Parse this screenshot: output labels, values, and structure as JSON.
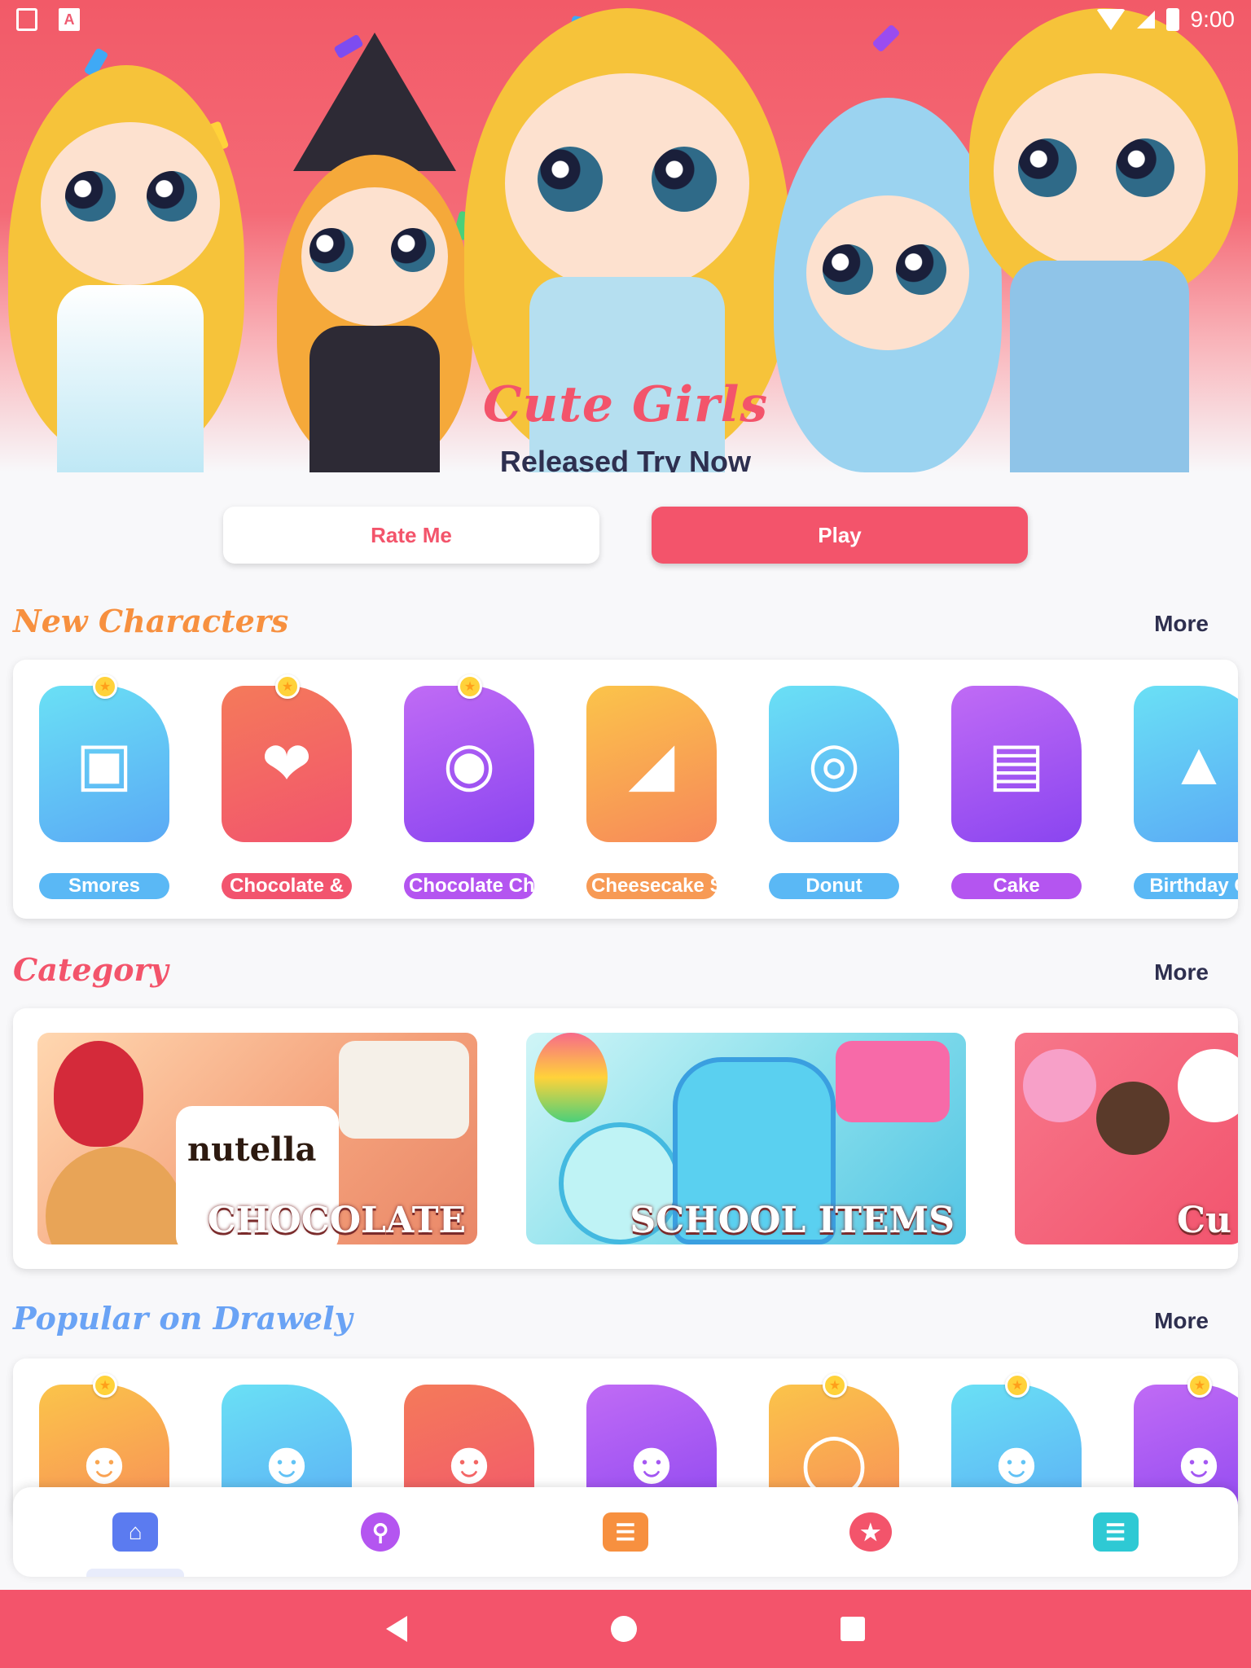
{
  "status_bar": {
    "time": "9:00",
    "app_icon": "A"
  },
  "hero": {
    "title": "Cute Girls",
    "subtitle": "Released Try Now"
  },
  "actions": {
    "rate_label": "Rate Me",
    "play_label": "Play"
  },
  "sections": {
    "new_characters": {
      "title": "New Characters",
      "more": "More",
      "title_color": "#f7903f",
      "items": [
        {
          "label": "Smores",
          "icon": "smores-icon",
          "color": "blue",
          "starred": true
        },
        {
          "label": "Chocolate &",
          "icon": "strawberry-icon",
          "color": "red",
          "starred": true
        },
        {
          "label": "Chocolate Ch",
          "icon": "cookie-icon",
          "color": "purple",
          "starred": true
        },
        {
          "label": "Cheesecake S",
          "icon": "cheesecake-icon",
          "color": "orange",
          "starred": false
        },
        {
          "label": "Donut",
          "icon": "donut-icon",
          "color": "blue",
          "starred": false
        },
        {
          "label": "Cake",
          "icon": "cake-icon",
          "color": "purple",
          "starred": false
        },
        {
          "label": "Birthday C",
          "icon": "cupcake-icon",
          "color": "blue",
          "starred": false
        }
      ]
    },
    "category": {
      "title": "Category",
      "more": "More",
      "title_color": "#f3546b",
      "items": [
        {
          "label": "CHOCOLATE",
          "overlay_brand": "nutella"
        },
        {
          "label": "SCHOOL ITEMS"
        },
        {
          "label": "Cu"
        }
      ]
    },
    "popular": {
      "title": "Popular on Drawely",
      "more": "More",
      "title_color": "#6aa3f5",
      "items": [
        {
          "icon": "harley-girl-icon",
          "color": "orange",
          "starred": true
        },
        {
          "icon": "brunette-girl-icon",
          "color": "blue",
          "starred": false
        },
        {
          "icon": "ponytail-girl-icon",
          "color": "red",
          "starred": false
        },
        {
          "icon": "princess-girl-icon",
          "color": "purple",
          "starred": false
        },
        {
          "icon": "marshmello-icon",
          "color": "orange",
          "starred": true
        },
        {
          "icon": "pink-hair-girl-icon",
          "color": "blue",
          "starred": true
        },
        {
          "icon": "red-dress-girl-icon",
          "color": "purple",
          "starred": true
        }
      ]
    }
  },
  "bottom_nav": [
    {
      "name": "home",
      "icon": "home-icon",
      "color": "#5b7bf0",
      "active": true
    },
    {
      "name": "search",
      "icon": "search-icon",
      "color": "#b455f0",
      "active": false
    },
    {
      "name": "categories",
      "icon": "folder-icon",
      "color": "#f7903f",
      "active": false
    },
    {
      "name": "favorites",
      "icon": "star-icon",
      "color": "#f3546b",
      "active": false
    },
    {
      "name": "news",
      "icon": "list-icon",
      "color": "#2ec9d4",
      "active": false
    }
  ]
}
